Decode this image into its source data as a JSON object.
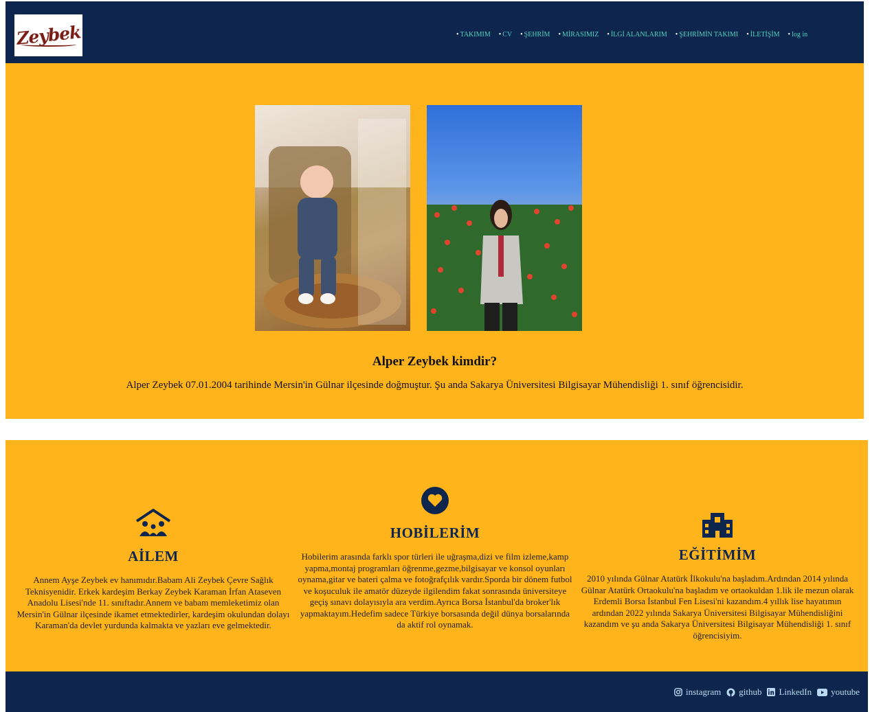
{
  "brand": {
    "logo_text": "Zeybek"
  },
  "nav": {
    "bullet": "•",
    "items": [
      {
        "label": "TAKIMIM"
      },
      {
        "label": "CV"
      },
      {
        "label": "ŞEHRİM"
      },
      {
        "label": "MİRASIMIZ"
      },
      {
        "label": "İLGİ ALANLARIM"
      },
      {
        "label": "ŞEHRİMİN TAKIMI"
      },
      {
        "label": "İLETİŞİM"
      },
      {
        "label": "log in"
      }
    ]
  },
  "hero": {
    "title": "Alper Zeybek kimdir?",
    "text": "Alper Zeybek 07.01.2004 tarihinde Mersin'in Gülnar ilçesinde doğmuştur. Şu anda Sakarya Üniversitesi Bilgisayar Mühendisliği 1. sınıf öğrencisidir."
  },
  "features": [
    {
      "icon": "family-home-icon",
      "title": "AİLEM",
      "text": "Annem Ayşe Zeybek ev hanımıdır.Babam Ali Zeybek Çevre Sağlık Teknisyenidir. Erkek kardeşim Berkay Zeybek Karaman İrfan Ataseven Anadolu Lisesi'nde 11. sınıftadır.Annem ve babam memleketimiz olan Mersin'in Gülnar ilçesinde ikamet etmektedirler, kardeşim okulundan dolayı Karaman'da devlet yurdunda kalmakta ve yazları eve gelmektedir."
    },
    {
      "icon": "heart-icon",
      "title": "HOBİLERİM",
      "text": "Hobilerim arasında farklı spor türleri ile uğraşma,dizi ve film izleme,kamp yapma,montaj programları öğrenme,gezme,bilgisayar ve konsol oyunları oynama,gitar ve bateri çalma ve fotoğrafçılık vardır.Sporda bir dönem futbol ve koşuculuk ile amatör düzeyde ilgilendim fakat sonrasında üniversiteye geçiş sınavı dolayısıyla ara verdim.Ayrıca Borsa İstanbul'da broker'lık yapmaktayım.Hedefim sadece Türkiye borsasında değil dünya borsalarında da aktif rol oynamak."
    },
    {
      "icon": "school-icon",
      "title": "EĞİTİMİM",
      "text": "2010 yılında Gülnar Atatürk İlkokulu'na başladım.Ardından 2014 yılında Gülnar Atatürk Ortaokulu'na başladım ve ortaokuldan 1.lik ile mezun olarak Erdemli Borsa İstanbul Fen Lisesi'ni kazandım.4 yıllık lise hayatımın ardından 2022 yılında Sakarya Üniversitesi Bilgisayar Mühendisliğini kazandım ve şu anda Sakarya Üniversitesi Bilgisayar Mühendisliği 1. sınıf öğrencisiyim."
    }
  ],
  "footer": {
    "links": [
      {
        "icon": "instagram-icon",
        "label": "instagram"
      },
      {
        "icon": "github-icon",
        "label": "github"
      },
      {
        "icon": "linkedin-icon",
        "label": "LinkedIn"
      },
      {
        "icon": "youtube-icon",
        "label": "youtube"
      }
    ]
  },
  "colors": {
    "navy": "#0e254d",
    "amber": "#ffb41b",
    "nav_link": "#4fd3c4"
  }
}
